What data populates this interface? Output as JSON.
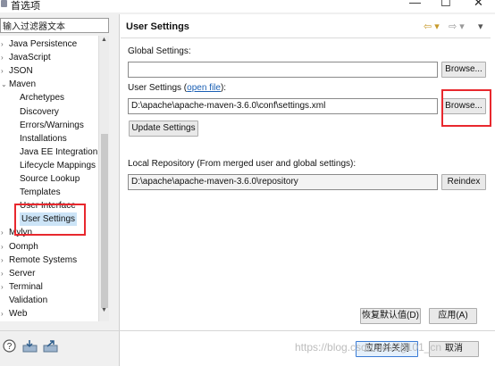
{
  "window": {
    "title": "首选项",
    "minimize": "—",
    "maximize": "☐",
    "close": "✕"
  },
  "filter": {
    "value": "输入过滤器文本"
  },
  "tree": {
    "items": [
      {
        "label": "Java Persistence",
        "expandable": true
      },
      {
        "label": "JavaScript",
        "expandable": true
      },
      {
        "label": "JSON",
        "expandable": true
      },
      {
        "label": "Maven",
        "expandable": true,
        "expanded": true
      },
      {
        "label": "Archetypes"
      },
      {
        "label": "Discovery"
      },
      {
        "label": "Errors/Warnings"
      },
      {
        "label": "Installations"
      },
      {
        "label": "Java EE Integration"
      },
      {
        "label": "Lifecycle Mappings"
      },
      {
        "label": "Source Lookup"
      },
      {
        "label": "Templates"
      },
      {
        "label": "User Interface"
      },
      {
        "label": "User Settings",
        "selected": true
      },
      {
        "label": "Mylyn",
        "expandable": true
      },
      {
        "label": "Oomph",
        "expandable": true
      },
      {
        "label": "Remote Systems",
        "expandable": true
      },
      {
        "label": "Server",
        "expandable": true
      },
      {
        "label": "Terminal",
        "expandable": true
      },
      {
        "label": "Validation"
      },
      {
        "label": "Web",
        "expandable": true
      }
    ]
  },
  "panel": {
    "title": "User Settings",
    "global_settings_label": "Global Settings:",
    "global_settings_value": "",
    "user_settings_label": "User Settings (",
    "user_settings_link": "open file",
    "user_settings_label_end": "):",
    "user_settings_value": "D:\\apache\\apache-maven-3.6.0\\conf\\settings.xml",
    "browse_label": "Browse...",
    "update_settings_label": "Update Settings",
    "local_repo_label": "Local Repository (From merged user and global settings):",
    "local_repo_value": "D:\\apache\\apache-maven-3.6.0\\repository",
    "reindex_label": "Reindex",
    "restore_defaults_label": "恢复默认值(D)",
    "apply_label": "应用(A)"
  },
  "footer": {
    "apply_close_label": "应用并关闭",
    "cancel_label": "取消",
    "watermark": "https://blog.csdn.net/Zg101_cn"
  },
  "colors": {
    "highlight": "#e8282e",
    "link": "#1a5fb4",
    "selection": "#cce4f7"
  }
}
